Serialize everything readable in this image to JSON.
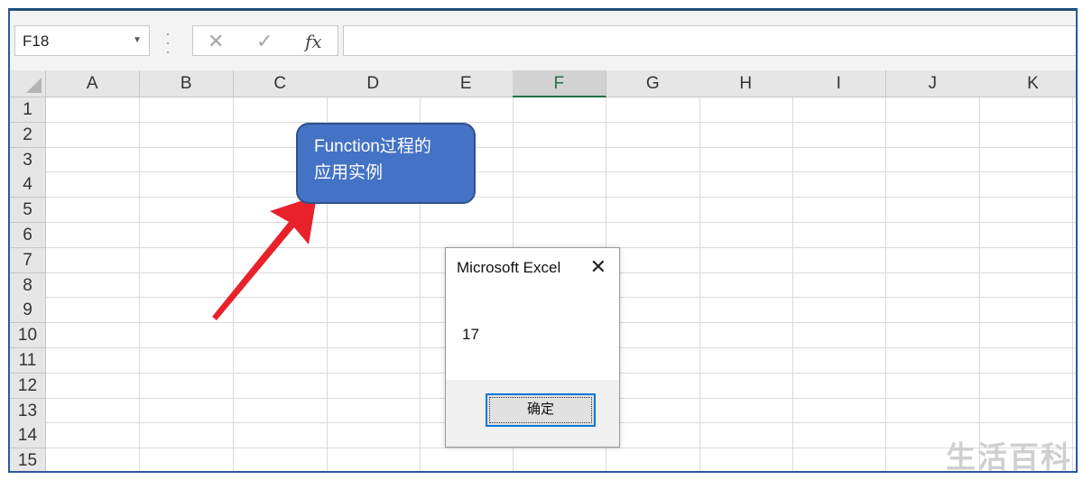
{
  "formula_bar": {
    "name_box": "F18",
    "cancel_symbol": "✕",
    "enter_symbol": "✓",
    "fx_label": "fx",
    "formula": ""
  },
  "columns": [
    "A",
    "B",
    "C",
    "D",
    "E",
    "F",
    "G",
    "H",
    "I",
    "J",
    "K"
  ],
  "selected_column": "F",
  "rows": [
    "1",
    "2",
    "3",
    "4",
    "5",
    "6",
    "7",
    "8",
    "9",
    "10",
    "11",
    "12",
    "13",
    "14",
    "15"
  ],
  "callout": {
    "line1": "Function过程的",
    "line2": "应用实例",
    "color": "#4472c4"
  },
  "arrow_color": "#e8212a",
  "dialog": {
    "title": "Microsoft Excel",
    "close_symbol": "✕",
    "message": "17",
    "ok_label": "确定"
  },
  "watermark": "生活百科",
  "accent": "#217346"
}
